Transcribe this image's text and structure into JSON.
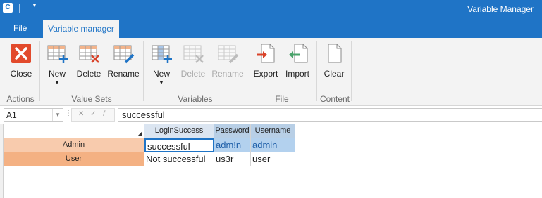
{
  "title_bar": {
    "app_icon_letter": "C",
    "title": "Variable Manager"
  },
  "tabs": {
    "file": "File",
    "active": "Variable manager"
  },
  "ribbon": {
    "groups": {
      "actions": "Actions",
      "value_sets": "Value Sets",
      "variables": "Variables",
      "file": "File",
      "content": "Content"
    },
    "buttons": {
      "close": "Close",
      "valueset_new": "New",
      "valueset_delete": "Delete",
      "valueset_rename": "Rename",
      "variable_new": "New",
      "variable_delete": "Delete",
      "variable_rename": "Rename",
      "export": "Export",
      "import": "Import",
      "clear": "Clear"
    },
    "disabled": [
      "variable_delete",
      "variable_rename"
    ]
  },
  "formula_bar": {
    "cell_ref": "A1",
    "value": "successful"
  },
  "grid": {
    "columns": [
      "LoginSuccess",
      "Password",
      "Username"
    ],
    "rows": [
      {
        "label": "Admin",
        "cells": [
          "successful",
          "adm!n",
          "admin"
        ]
      },
      {
        "label": "User",
        "cells": [
          "Not successful",
          "us3r",
          "user"
        ]
      }
    ]
  },
  "colors": {
    "accent": "#1f74c6",
    "row_header_admin": "#f8cbad",
    "row_header_user": "#f4b183",
    "selection": "#b3d1ee"
  }
}
